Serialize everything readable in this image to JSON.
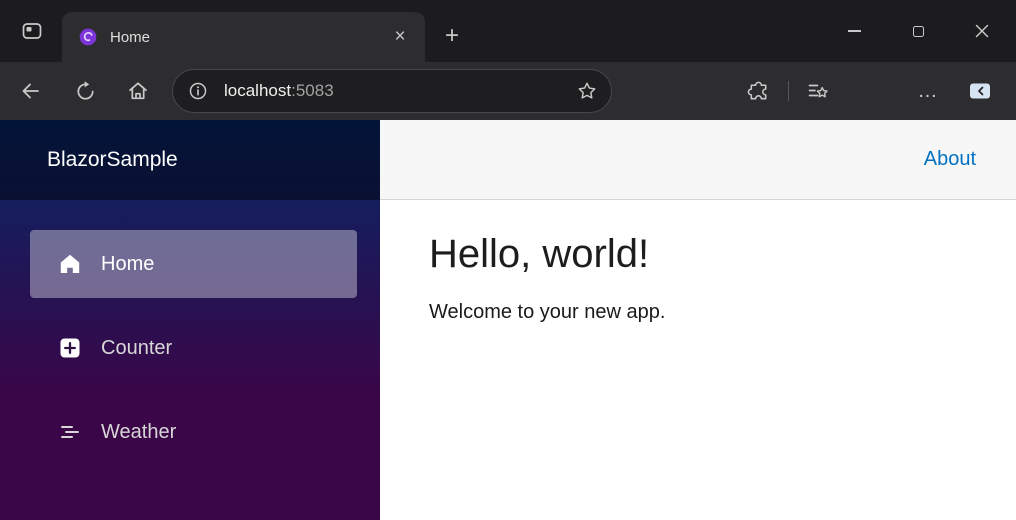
{
  "colors": {
    "titlebar_bg": "#1c1c1e",
    "toolbar_bg": "#2d2d30",
    "sidebar_gradient_top": "#052767",
    "sidebar_gradient_bottom": "#3a0647",
    "nav_active_bg": "rgba(255,255,255,0.37)",
    "link_blue": "#0071c1",
    "favicon_purple": "#7b35d8"
  },
  "icons": {
    "tab_close": "×",
    "new_tab": "+",
    "more_menu": "…"
  },
  "browser": {
    "tab": {
      "title": "Home"
    },
    "address": {
      "host": "localhost",
      "port": ":5083"
    }
  },
  "app": {
    "brand": "BlazorSample",
    "nav": [
      {
        "label": "Home",
        "icon": "house-icon",
        "active": true
      },
      {
        "label": "Counter",
        "icon": "plus-square-icon",
        "active": false
      },
      {
        "label": "Weather",
        "icon": "list-nested-icon",
        "active": false
      }
    ],
    "header": {
      "about": "About"
    },
    "content": {
      "heading": "Hello, world!",
      "welcome": "Welcome to your new app."
    }
  }
}
